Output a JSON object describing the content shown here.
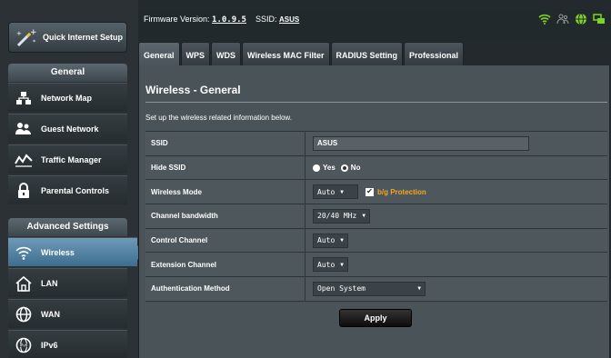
{
  "sidebar": {
    "quick_setup_label": "Quick Internet Setup",
    "general_heading": "General",
    "general_items": [
      {
        "label": "Network Map",
        "icon": "network-map-icon"
      },
      {
        "label": "Guest Network",
        "icon": "guest-network-icon"
      },
      {
        "label": "Traffic Manager",
        "icon": "traffic-manager-icon"
      },
      {
        "label": "Parental Controls",
        "icon": "parental-controls-icon"
      }
    ],
    "advanced_heading": "Advanced Settings",
    "advanced_items": [
      {
        "label": "Wireless",
        "icon": "wireless-icon",
        "active": true
      },
      {
        "label": "LAN",
        "icon": "lan-icon"
      },
      {
        "label": "WAN",
        "icon": "wan-icon"
      },
      {
        "label": "IPv6",
        "icon": "ipv6-icon"
      }
    ]
  },
  "topbar": {
    "firmware_label": "Firmware Version:",
    "firmware_value": "1.0.9.5",
    "ssid_label": "SSID:",
    "ssid_value": "ASUS",
    "status_icons": [
      "wifi-status-icon",
      "user-status-icon",
      "internet-status-icon",
      "usb-status-icon"
    ],
    "accent": "#7ed321"
  },
  "tabs": [
    {
      "label": "General",
      "active": true
    },
    {
      "label": "WPS"
    },
    {
      "label": "WDS"
    },
    {
      "label": "Wireless MAC Filter"
    },
    {
      "label": "RADIUS Setting"
    },
    {
      "label": "Professional"
    }
  ],
  "main": {
    "title": "Wireless - General",
    "description": "Set up the wireless related information below.",
    "fields": {
      "ssid": {
        "label": "SSID",
        "value": "ASUS"
      },
      "hide_ssid": {
        "label": "Hide SSID",
        "yes": "Yes",
        "no": "No",
        "selected": "No"
      },
      "wireless_mode": {
        "label": "Wireless Mode",
        "value": "Auto",
        "checkbox_label": "b/g Protection",
        "checked": true
      },
      "channel_bandwidth": {
        "label": "Channel bandwidth",
        "value": "20/40 MHz"
      },
      "control_channel": {
        "label": "Control Channel",
        "value": "Auto"
      },
      "extension_channel": {
        "label": "Extension Channel",
        "value": "Auto"
      },
      "auth_method": {
        "label": "Authentication Method",
        "value": "Open System"
      }
    },
    "apply_label": "Apply"
  }
}
